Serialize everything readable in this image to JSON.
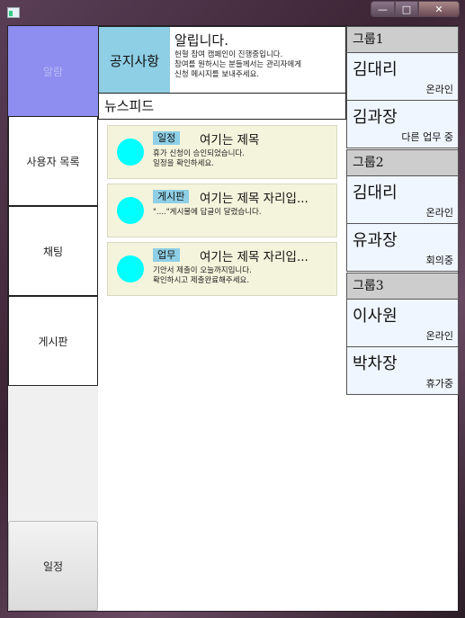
{
  "window": {
    "minimize": "—",
    "maximize": "□",
    "close": "✕"
  },
  "nav": {
    "items": [
      {
        "label": "알람"
      },
      {
        "label": "사용자 목록"
      },
      {
        "label": "채팅"
      },
      {
        "label": "게시판"
      }
    ],
    "bottom": {
      "label": "일정"
    }
  },
  "notice": {
    "label": "공지사항",
    "title": "알립니다.",
    "body": "헌혈 참여 캠페인이 진행중입니다.\n참여를 원하시는 분들께서는 관리자에게\n신청 메시지를 보내주세요."
  },
  "newsfeed": {
    "title": "뉴스피드"
  },
  "cards": [
    {
      "tag": "일정",
      "title": "여기는 제목",
      "body": "휴가 신청이 승인되었습니다.\n일정을 확인하세요."
    },
    {
      "tag": "게시판",
      "title": "여기는 제목 자리입...",
      "body": "\"....\"게시물에 답글이 달렸습니다."
    },
    {
      "tag": "업무",
      "title": "여기는 제목 자리입...",
      "body": "기안서 제출이 오늘까지입니다.\n확인하시고 제출완료해주세요."
    }
  ],
  "groups": [
    {
      "name": "그룹1",
      "members": [
        {
          "name": "김대리",
          "status": "온라인"
        },
        {
          "name": "김과장",
          "status": "다른 업무 중"
        }
      ]
    },
    {
      "name": "그룹2",
      "members": [
        {
          "name": "김대리",
          "status": "온라인"
        },
        {
          "name": "유과장",
          "status": "회의중"
        }
      ]
    },
    {
      "name": "그룹3",
      "members": [
        {
          "name": "이사원",
          "status": "온라인"
        },
        {
          "name": "박차장",
          "status": "휴가중"
        }
      ]
    }
  ],
  "colors": {
    "nav_active": "#8e8ef0",
    "notice_label": "#8ecfe6",
    "card_bg": "#f4f4dc",
    "card_dot": "#00ffff",
    "group_header": "#cdcdcd",
    "member_bg": "#f0f6ff"
  }
}
